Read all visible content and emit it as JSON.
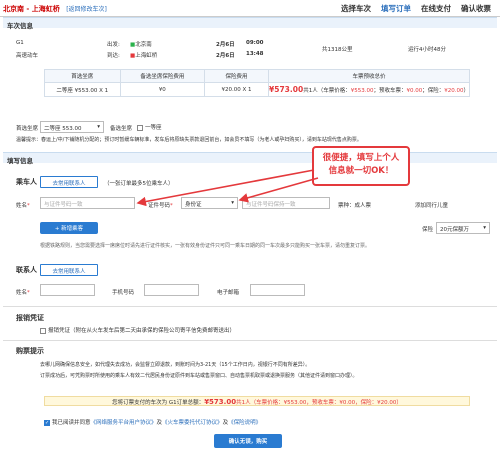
{
  "header": {
    "route": "北京南 - 上海虹桥",
    "back_link": "[返回修改车次]",
    "steps": [
      "选择车次",
      "填写订单",
      "在线支付",
      "确认收票"
    ],
    "current_step": 1
  },
  "train": {
    "section_title": "车次信息",
    "number": "G1",
    "type": "高速动车",
    "depart_label": "出发:",
    "depart_station": "北京南",
    "arrive_label": "到达:",
    "arrive_station": "上海虹桥",
    "depart_date": "2月6日",
    "depart_time": "09:00",
    "arrive_date": "2月6日",
    "arrive_time": "13:48",
    "distance": "共1318公里",
    "duration": "运行4小时48分"
  },
  "price_table": {
    "headers": [
      "首选坐席",
      "备选坐席保险费用",
      "保险费用",
      "车票预收总价"
    ],
    "row": {
      "seat": "二等座 ¥553.00 X 1",
      "alt_seat_fee": "¥0",
      "insurance": "¥20.00 X 1",
      "total_amount": "¥573.00",
      "total_detail_prefix": "共1人（车票价格：",
      "ticket_price": "¥553.00",
      "alt_prefix": "；预收车票：",
      "alt_price": "¥0.00",
      "ins_prefix": "；保险：",
      "ins_price": "¥20.00",
      "close": "）"
    }
  },
  "seat_select": {
    "first_label": "首选坐席",
    "first_value": "二等座 553.00",
    "backup_label": "备选坐席",
    "backup_option": "一等座"
  },
  "warning": "温馨提示：春运上/中/下铺随机分配的；预订时暂缓车辆标准，发车后将原缺失票款退回前台，如会员不填写（为老人或孕妇购买），请到车站现代售点购票。",
  "passenger": {
    "section_title": "填写信息",
    "label": "乘车人",
    "add_contacts_btn": "去常用联系人",
    "add_note": "（一张订单最多5位乘车人）",
    "name_label": "姓名",
    "name_placeholder": "与证件号码一致",
    "id_type_label": "证件号码",
    "id_type": "身份证",
    "id_placeholder": "与证件号码保持一致",
    "ticket_label": "票种：",
    "ticket_type": "成人票",
    "add_child": "添加同行儿童",
    "add_passenger_btn": "+ 新增乘客",
    "insurance_label": "保险",
    "insurance_value": "20元保额万",
    "note": "根据铁路规则，当您需要选择一席席位时请先进行证件核实，一张有效身份证件只可同一乘车日期的同一车次最多只能购买一张车票，请勿重复订票。"
  },
  "callout": {
    "line1": "很便捷，填写上个人",
    "line2": "信息就一切OK！"
  },
  "contact": {
    "label": "联系人",
    "btn": "去常用联系人",
    "name_label": "姓名",
    "phone_label": "手机号码",
    "email_label": "电子邮箱"
  },
  "invoice": {
    "title": "报销凭证",
    "option": "报销凭证（附在从火车发车后第二天由承保的保险公司寄平信免费邮寄送出）"
  },
  "notice": {
    "title": "购票提示",
    "line1": "去哪儿网确保信息安全，如代理失去成功，会监督立即退款，到账时间为3-21天（15个工作日内，视银行不同有所差异）。",
    "line2": "订票成功后，可凭购票时所使用的乘车人有效二代居民身份证原件到车站或售票窗口、自动售票机取票或退换票服务（其他证件请到窗口办理）。"
  },
  "summary": {
    "prefix": "您将订票支付的车次为 G1订单总额：",
    "amount": "¥573.00",
    "detail": "共1人（车票价格：¥553.00，预收车票：¥0.00，保险：¥20.00）"
  },
  "agree": {
    "prefix": "我已阅读并同意",
    "link1": "《网络服务平台用户协议》",
    "mid": "及",
    "link2": "《火车票委托代订协议》",
    "mid2": "及",
    "link3": "《保险说明》"
  },
  "submit_label": "确认无误，购买"
}
